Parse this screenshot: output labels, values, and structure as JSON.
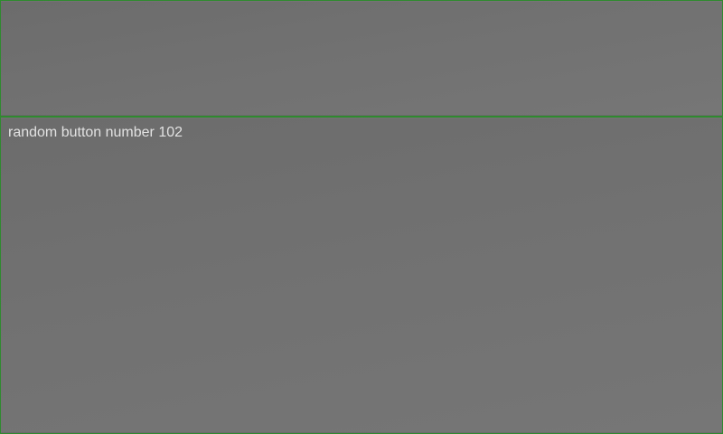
{
  "buttons": {
    "top": {
      "label": ""
    },
    "bottom": {
      "label": "random button number 102"
    }
  },
  "colors": {
    "background": "#6e6e6e",
    "border": "#2f8a2f",
    "label_text": "#e2e2e2"
  }
}
